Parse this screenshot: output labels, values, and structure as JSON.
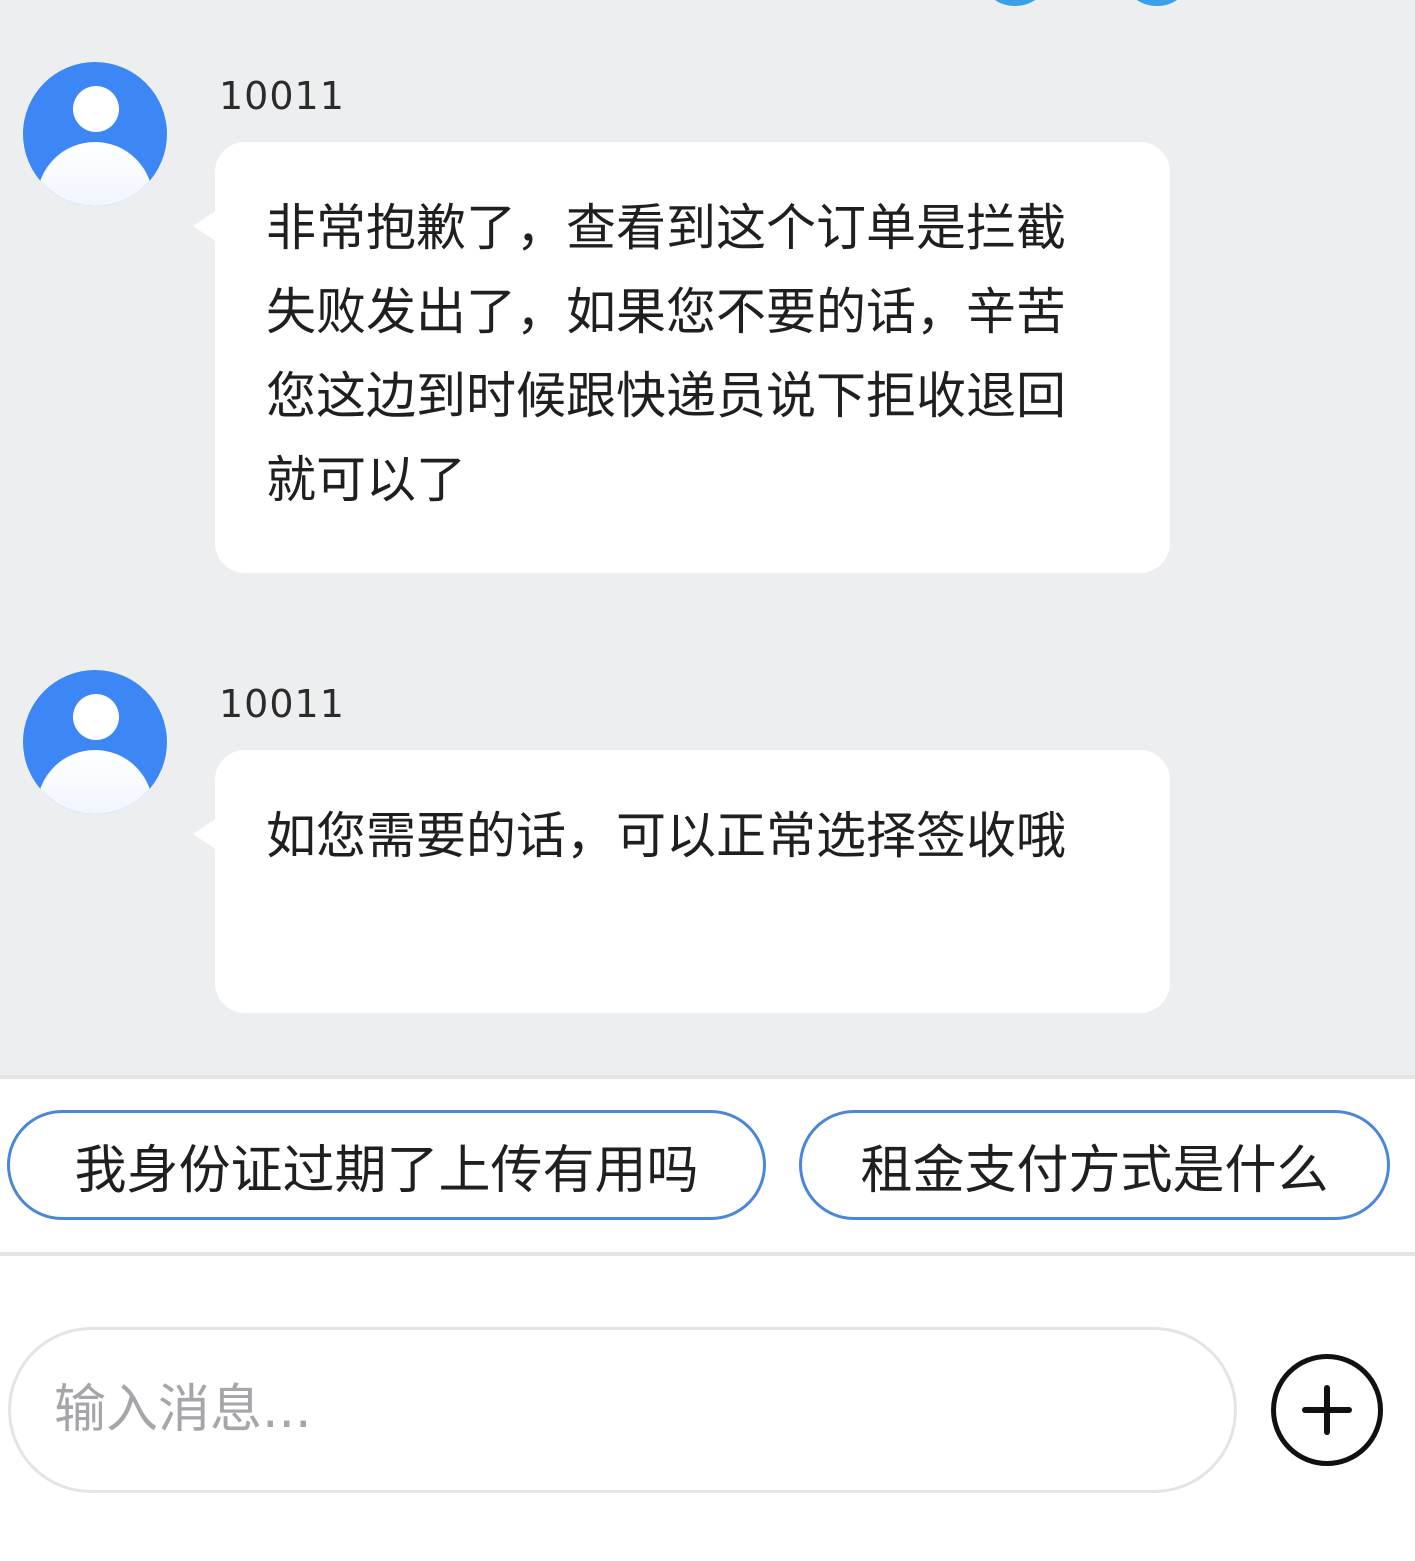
{
  "messages": [
    {
      "sender": "10011",
      "text": "非常抱歉了，查看到这个订单是拦截失败发出了，如果您不要的话，辛苦您这边到时候跟快递员说下拒收退回就可以了"
    },
    {
      "sender": "10011",
      "text": "如您需要的话，可以正常选择签收哦"
    }
  ],
  "quick_replies": [
    "我身份证过期了上传有用吗",
    "租金支付方式是什么"
  ],
  "composer": {
    "placeholder": "输入消息..."
  },
  "icons": {
    "avatar": "user-avatar-icon",
    "add": "plus-icon"
  },
  "colors": {
    "chat_background": "#edeef0",
    "avatar": "#3d86f5",
    "chip_border": "#4a86d9"
  }
}
